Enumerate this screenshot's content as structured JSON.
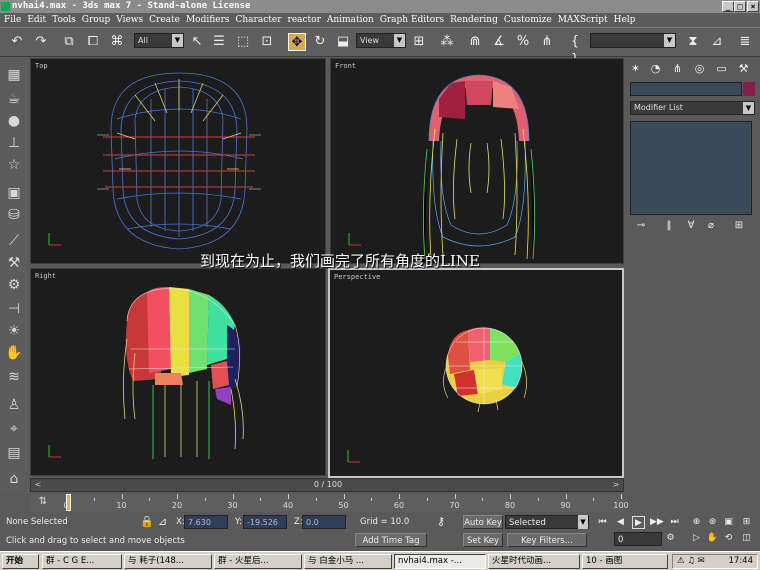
{
  "window": {
    "title": "nvhai4.max - 3ds max 7 - Stand-alone License"
  },
  "menu": [
    "File",
    "Edit",
    "Tools",
    "Group",
    "Views",
    "Create",
    "Modifiers",
    "Character",
    "reactor",
    "Animation",
    "Graph Editors",
    "Rendering",
    "Customize",
    "MAXScript",
    "Help"
  ],
  "toolbar": {
    "filter_value": "All",
    "refcoord_value": "View"
  },
  "viewports": {
    "top": "Top",
    "front": "Front",
    "right": "Right",
    "perspective": "Perspective"
  },
  "subtitle": "到现在为止，我们画完了所有角度的LINE",
  "command_panel": {
    "modifier_list": "Modifier List"
  },
  "timeline": {
    "frame_text": "0 / 100",
    "ticks": [
      "0",
      "10",
      "20",
      "30",
      "40",
      "50",
      "60",
      "70",
      "80",
      "90",
      "100"
    ]
  },
  "status": {
    "selection": "None Selected",
    "prompt": "Click and drag to select and move objects",
    "x_label": "X:",
    "x_value": "7.630",
    "y_label": "Y:",
    "y_value": "-19.526",
    "z_label": "Z:",
    "z_value": "0.0",
    "grid": "Grid = 10.0",
    "add_time_tag": "Add Time Tag",
    "auto_key": "Auto Key",
    "set_key": "Set Key",
    "key_mode": "Selected",
    "key_filters": "Key Filters...",
    "frame": "0"
  },
  "taskbar": {
    "start": "开始",
    "tasks": [
      "群 - C G E...",
      "与 耗子(148...",
      "群 - 火星后...",
      "与 白金小马 ...",
      "nvhai4.max -...",
      "火星时代动画...",
      "10 - 画图"
    ],
    "clock": "17:44"
  },
  "colors": {
    "viewport_bg": "#1c1c1c",
    "active_border": "#c8c8c8",
    "accent": "#d8a94a"
  }
}
